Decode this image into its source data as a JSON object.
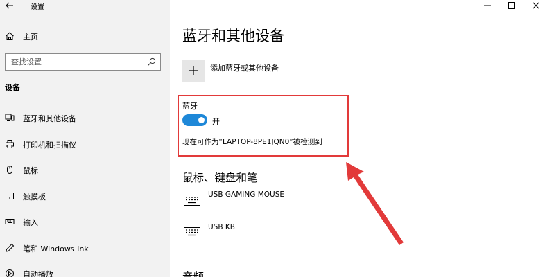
{
  "window": {
    "title": "设置"
  },
  "sidebar": {
    "home_label": "主页",
    "search_placeholder": "查找设置",
    "section_heading": "设备",
    "items": [
      {
        "label": "蓝牙和其他设备",
        "icon": "bluetooth-devices-icon"
      },
      {
        "label": "打印机和扫描仪",
        "icon": "printer-icon"
      },
      {
        "label": "鼠标",
        "icon": "mouse-icon"
      },
      {
        "label": "触摸板",
        "icon": "touchpad-icon"
      },
      {
        "label": "输入",
        "icon": "keyboard-icon"
      },
      {
        "label": "笔和 Windows Ink",
        "icon": "pen-icon"
      },
      {
        "label": "自动播放",
        "icon": "autoplay-icon"
      }
    ]
  },
  "main": {
    "title": "蓝牙和其他设备",
    "add_device_label": "添加蓝牙或其他设备",
    "bluetooth": {
      "label": "蓝牙",
      "toggle_state": "开",
      "toggle_on": true,
      "discoverable_text": "现在可作为“LAPTOP-8PE1JQN0”被检测到"
    },
    "mouse_section": {
      "title": "鼠标、键盘和笔",
      "devices": [
        {
          "name": "USB GAMING MOUSE",
          "icon": "keyboard-icon"
        },
        {
          "name": "USB KB",
          "icon": "keyboard-icon"
        }
      ]
    },
    "audio_section": {
      "title": "音频"
    }
  },
  "colors": {
    "sidebar_bg": "#f2f2f2",
    "accent": "#1e88d8",
    "highlight": "#e23a3a"
  }
}
